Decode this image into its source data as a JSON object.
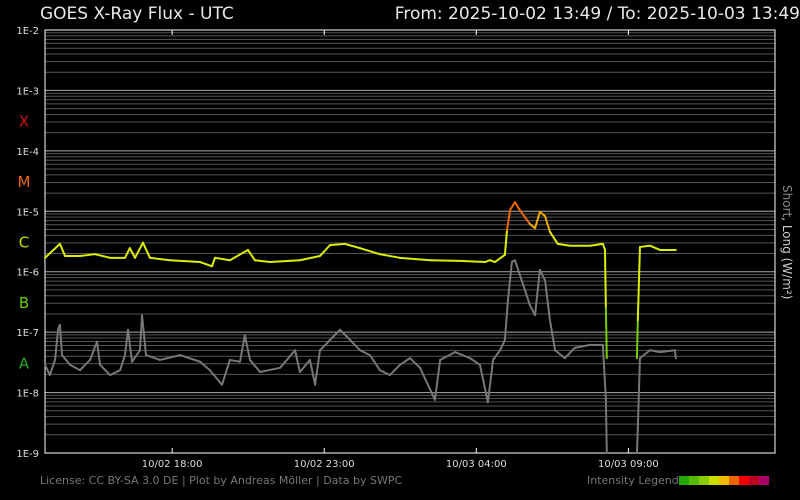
{
  "header": {
    "title": "GOES X-Ray Flux - UTC",
    "range": "From: 2025-10-02 13:49  /  To: 2025-10-03 13:49"
  },
  "footer": {
    "license": "License: CC BY-SA 3.0 DE | Plot by Andreas Möller | Data by SWPC",
    "legend_label": "Intensity Legend"
  },
  "legend_colors": [
    "#22aa00",
    "#55bb00",
    "#88cc00",
    "#ccdd00",
    "#eebb00",
    "#ee6600",
    "#ee0000",
    "#bb0022",
    "#aa0066"
  ],
  "chart_data": {
    "type": "line",
    "title": "GOES X-Ray Flux - UTC",
    "ylabel_short": "Short",
    "ylabel_long": ", Long (W/m²)",
    "yscale": "log",
    "ylim_log10": [
      -9,
      -2
    ],
    "y_ticks": [
      "1E-2",
      "1E-3",
      "1E-4",
      "1E-5",
      "1E-6",
      "1E-7",
      "1E-8",
      "1E-9"
    ],
    "classes": [
      {
        "label": "X",
        "color": "#cc1111",
        "log10": -3.5
      },
      {
        "label": "M",
        "color": "#ee6600",
        "log10": -4.5
      },
      {
        "label": "C",
        "color": "#ccdd00",
        "log10": -5.5
      },
      {
        "label": "B",
        "color": "#66cc00",
        "log10": -6.5
      },
      {
        "label": "A",
        "color": "#22aa22",
        "log10": -7.5
      }
    ],
    "x_unit": "hours since 2025-10-02 13:49 UTC",
    "xlim": [
      0,
      24
    ],
    "x_ticks": [
      {
        "label": "10/02 18:00",
        "h": 4.18
      },
      {
        "label": "10/02 23:00",
        "h": 9.18
      },
      {
        "label": "10/03 04:00",
        "h": 14.18
      },
      {
        "label": "10/03 09:00",
        "h": 19.18
      }
    ],
    "series": [
      {
        "name": "Long",
        "color": "intensity",
        "points": [
          [
            0,
            -5.77
          ],
          [
            0.49,
            -5.54
          ],
          [
            0.66,
            -5.74
          ],
          [
            1.15,
            -5.74
          ],
          [
            1.64,
            -5.71
          ],
          [
            2.14,
            -5.77
          ],
          [
            2.63,
            -5.77
          ],
          [
            2.79,
            -5.61
          ],
          [
            2.96,
            -5.77
          ],
          [
            3.22,
            -5.52
          ],
          [
            3.45,
            -5.77
          ],
          [
            4.11,
            -5.81
          ],
          [
            5.1,
            -5.84
          ],
          [
            5.49,
            -5.91
          ],
          [
            5.59,
            -5.77
          ],
          [
            6.08,
            -5.81
          ],
          [
            6.67,
            -5.64
          ],
          [
            6.9,
            -5.81
          ],
          [
            7.4,
            -5.84
          ],
          [
            8.38,
            -5.81
          ],
          [
            9.04,
            -5.74
          ],
          [
            9.37,
            -5.56
          ],
          [
            9.86,
            -5.54
          ],
          [
            10.36,
            -5.61
          ],
          [
            11.01,
            -5.71
          ],
          [
            11.67,
            -5.77
          ],
          [
            12.66,
            -5.81
          ],
          [
            13.64,
            -5.82
          ],
          [
            14.46,
            -5.84
          ],
          [
            14.63,
            -5.81
          ],
          [
            14.79,
            -5.84
          ],
          [
            15.12,
            -5.72
          ],
          [
            15.19,
            -5.31
          ],
          [
            15.29,
            -4.98
          ],
          [
            15.45,
            -4.85
          ],
          [
            15.61,
            -4.98
          ],
          [
            15.94,
            -5.21
          ],
          [
            16.11,
            -5.28
          ],
          [
            16.27,
            -5.01
          ],
          [
            16.44,
            -5.08
          ],
          [
            16.6,
            -5.34
          ],
          [
            16.86,
            -5.54
          ],
          [
            17.26,
            -5.57
          ],
          [
            17.92,
            -5.57
          ],
          [
            18.34,
            -5.54
          ],
          [
            18.41,
            -5.64
          ],
          [
            18.44,
            -6.6
          ],
          [
            18.47,
            -7.43
          ],
          null,
          [
            19.46,
            -7.43
          ],
          [
            19.49,
            -6.8
          ],
          [
            19.56,
            -5.59
          ],
          [
            19.89,
            -5.57
          ],
          [
            20.22,
            -5.64
          ],
          [
            20.74,
            -5.64
          ]
        ]
      },
      {
        "name": "Short",
        "color": "#777777",
        "points": [
          [
            0,
            -7.54
          ],
          [
            0.16,
            -7.71
          ],
          [
            0.33,
            -7.46
          ],
          [
            0.43,
            -6.96
          ],
          [
            0.49,
            -6.88
          ],
          [
            0.56,
            -7.38
          ],
          [
            0.82,
            -7.54
          ],
          [
            1.15,
            -7.63
          ],
          [
            1.48,
            -7.46
          ],
          [
            1.71,
            -7.16
          ],
          [
            1.81,
            -7.54
          ],
          [
            2.14,
            -7.71
          ],
          [
            2.47,
            -7.63
          ],
          [
            2.63,
            -7.38
          ],
          [
            2.73,
            -6.96
          ],
          [
            2.86,
            -7.49
          ],
          [
            3.12,
            -7.3
          ],
          [
            3.19,
            -6.72
          ],
          [
            3.32,
            -7.38
          ],
          [
            3.78,
            -7.46
          ],
          [
            4.44,
            -7.38
          ],
          [
            5.1,
            -7.49
          ],
          [
            5.42,
            -7.63
          ],
          [
            5.82,
            -7.87
          ],
          [
            6.08,
            -7.46
          ],
          [
            6.41,
            -7.49
          ],
          [
            6.57,
            -7.05
          ],
          [
            6.74,
            -7.46
          ],
          [
            7.07,
            -7.66
          ],
          [
            7.73,
            -7.59
          ],
          [
            8.22,
            -7.3
          ],
          [
            8.38,
            -7.66
          ],
          [
            8.71,
            -7.46
          ],
          [
            8.88,
            -7.87
          ],
          [
            9.04,
            -7.3
          ],
          [
            9.37,
            -7.13
          ],
          [
            9.7,
            -6.96
          ],
          [
            10.03,
            -7.13
          ],
          [
            10.36,
            -7.3
          ],
          [
            10.68,
            -7.38
          ],
          [
            11.01,
            -7.63
          ],
          [
            11.34,
            -7.71
          ],
          [
            11.67,
            -7.54
          ],
          [
            12.0,
            -7.43
          ],
          [
            12.33,
            -7.59
          ],
          [
            12.82,
            -8.12
          ],
          [
            12.99,
            -7.46
          ],
          [
            13.48,
            -7.33
          ],
          [
            13.97,
            -7.43
          ],
          [
            14.3,
            -7.54
          ],
          [
            14.56,
            -8.16
          ],
          [
            14.73,
            -7.46
          ],
          [
            14.96,
            -7.3
          ],
          [
            15.12,
            -7.13
          ],
          [
            15.22,
            -6.47
          ],
          [
            15.35,
            -5.84
          ],
          [
            15.45,
            -5.81
          ],
          [
            15.61,
            -6.05
          ],
          [
            15.94,
            -6.55
          ],
          [
            16.11,
            -6.72
          ],
          [
            16.27,
            -5.97
          ],
          [
            16.44,
            -6.14
          ],
          [
            16.6,
            -6.8
          ],
          [
            16.77,
            -7.3
          ],
          [
            17.09,
            -7.43
          ],
          [
            17.42,
            -7.26
          ],
          [
            17.92,
            -7.21
          ],
          [
            18.34,
            -7.21
          ],
          [
            18.44,
            -8.12
          ],
          [
            18.47,
            -9.0
          ],
          null,
          [
            19.46,
            -9.0
          ],
          [
            19.49,
            -8.59
          ],
          [
            19.56,
            -7.43
          ],
          [
            19.89,
            -7.3
          ],
          [
            20.22,
            -7.33
          ],
          [
            20.71,
            -7.3
          ],
          [
            20.74,
            -7.43
          ]
        ]
      }
    ]
  }
}
